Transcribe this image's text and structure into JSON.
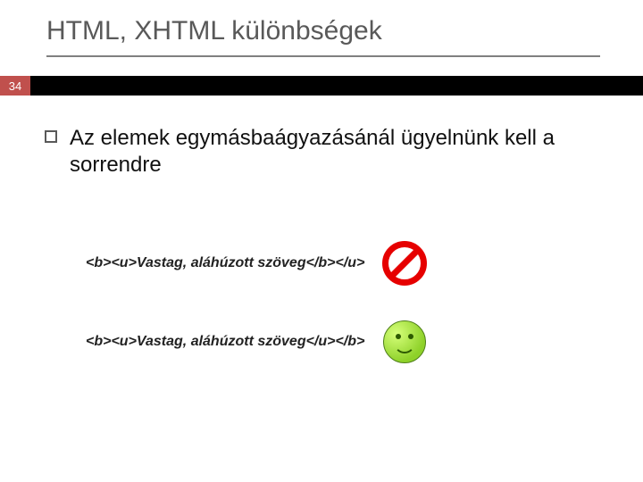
{
  "slide": {
    "title": "HTML, XHTML különbségek",
    "number": "34",
    "bullet": "Az elemek egymásbaágyazásánál ügyelnünk kell a sorrendre",
    "examples": [
      {
        "code": "<b><u>Vastag, aláhúzott szöveg</b></u>",
        "verdict": "invalid"
      },
      {
        "code": "<b><u>Vastag, aláhúzott szöveg</u></b>",
        "verdict": "valid"
      }
    ]
  }
}
